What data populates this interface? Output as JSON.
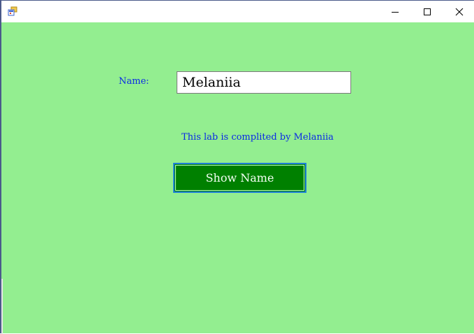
{
  "window": {
    "title": "",
    "icon": "winforms-app-icon",
    "controls": {
      "minimize": "minimize-icon",
      "maximize": "maximize-icon",
      "close": "close-icon"
    }
  },
  "form": {
    "background_color": "#93ee90",
    "name_label": "Name:",
    "name_input_value": "Melaniia",
    "info_text": "This lab is complited by Melaniia",
    "show_button_label": "Show Name",
    "label_color": "#0a28e6",
    "button_color": "#008000"
  }
}
